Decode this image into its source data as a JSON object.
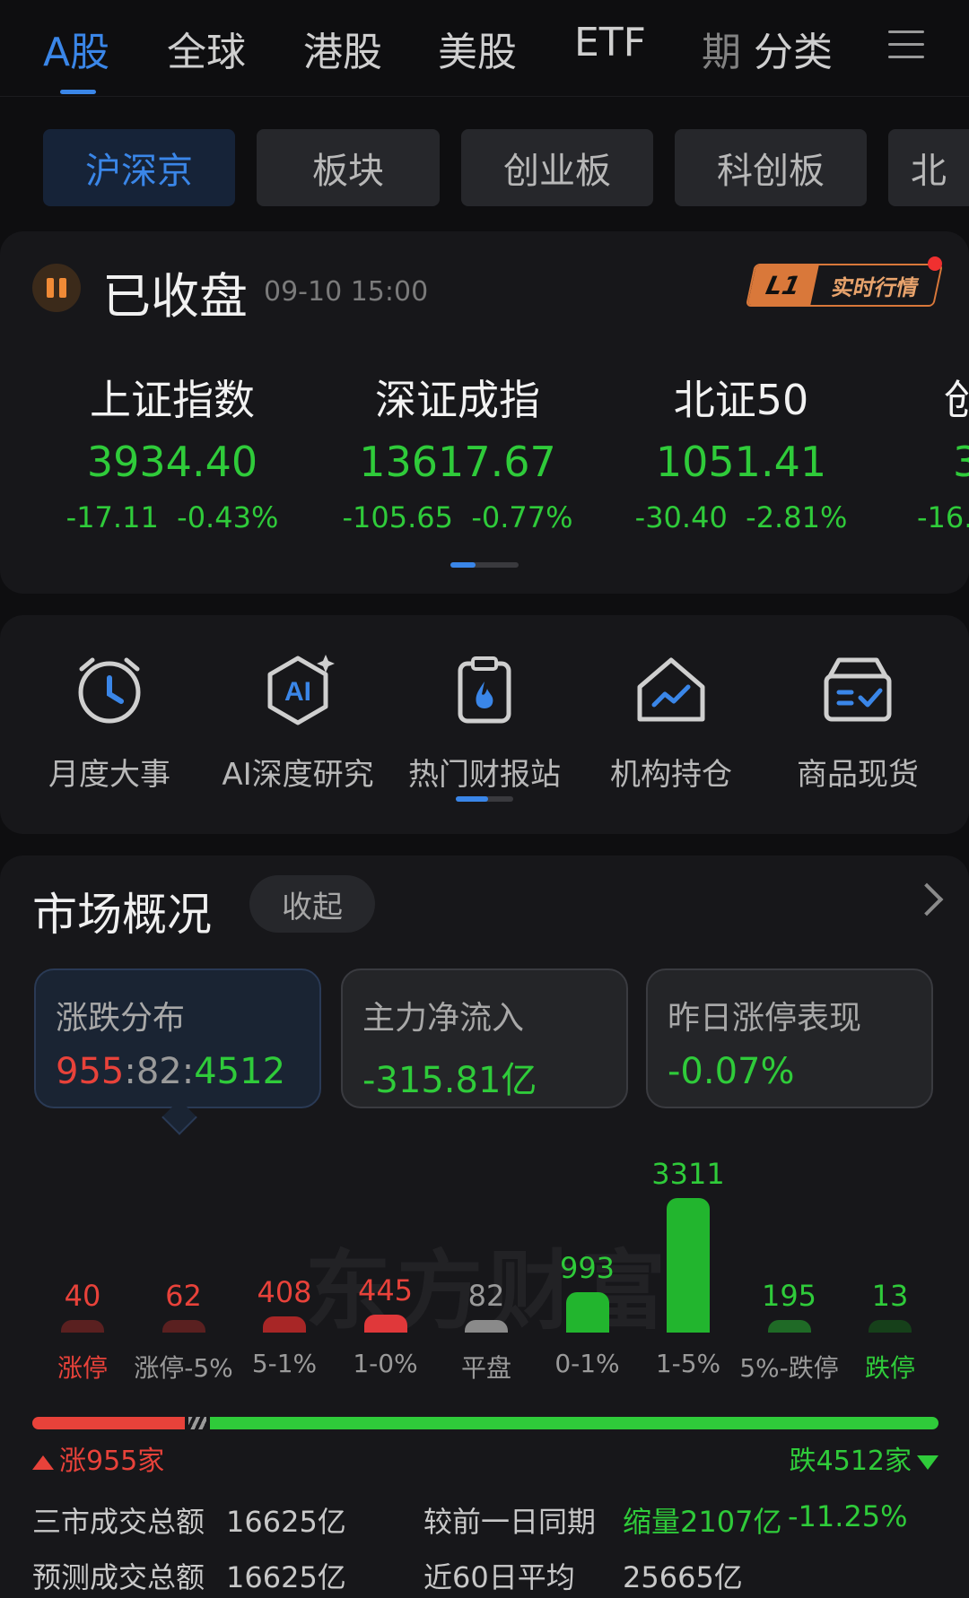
{
  "nav": {
    "tabs": [
      {
        "label": "A股",
        "active": true
      },
      {
        "label": "全球"
      },
      {
        "label": "港股"
      },
      {
        "label": "美股"
      },
      {
        "label": "ETF"
      },
      {
        "label": "期"
      },
      {
        "label": "分类"
      }
    ],
    "menu_icon": "hamburger-icon"
  },
  "subtabs": [
    "沪深京",
    "板块",
    "创业板",
    "科创板",
    "北"
  ],
  "status": {
    "title": "已收盘",
    "time": "09-10  15:00",
    "badge_left": "L1",
    "badge_right": "实时行情"
  },
  "indices": [
    {
      "name": "上证指数",
      "value": "3934.40",
      "change": "-17.11",
      "pct": "-0.43%"
    },
    {
      "name": "深证成指",
      "value": "13617.67",
      "change": "-105.65",
      "pct": "-0.77%"
    },
    {
      "name": "北证50",
      "value": "1051.41",
      "change": "-30.40",
      "pct": "-2.81%"
    },
    {
      "name": "创",
      "value": "3",
      "change": "-16.",
      "pct": ""
    }
  ],
  "shortcuts": [
    {
      "label": "月度大事",
      "icon": "alarm-clock-icon"
    },
    {
      "label": "AI深度研究",
      "icon": "ai-hexagon-icon"
    },
    {
      "label": "热门财报站",
      "icon": "hot-report-icon"
    },
    {
      "label": "机构持仓",
      "icon": "house-chart-icon"
    },
    {
      "label": "商品现货",
      "icon": "goods-box-icon"
    }
  ],
  "market": {
    "title": "市场概况",
    "collapse_label": "收起",
    "stats": [
      {
        "label": "涨跌分布",
        "up": "955",
        "flat": "82",
        "down": "4512"
      },
      {
        "label": "主力净流入",
        "value": "-315.81亿"
      },
      {
        "label": "昨日涨停表现",
        "value": "-0.07%"
      }
    ],
    "watermark": "东方财富",
    "up_label": "涨955家",
    "down_label": "跌4512家",
    "colors": {
      "up": "#e8423a",
      "down": "#2fcb3a",
      "flat": "#9a9a9a"
    }
  },
  "chart_data": {
    "type": "bar",
    "categories": [
      "涨停",
      "涨停-5%",
      "5-1%",
      "1-0%",
      "平盘",
      "0-1%",
      "1-5%",
      "5%-跌停",
      "跌停"
    ],
    "values": [
      40,
      62,
      408,
      445,
      82,
      993,
      3311,
      195,
      13
    ]
  },
  "turnover": {
    "total_label": "三市成交总额",
    "total_value": "16625亿",
    "compare_label": "较前一日同期",
    "compare_value": "缩量2107亿",
    "compare_pct": "-11.25%",
    "forecast_label": "预测成交总额",
    "forecast_value": "16625亿",
    "avg60_label": "近60日平均",
    "avg60_value": "25665亿"
  }
}
